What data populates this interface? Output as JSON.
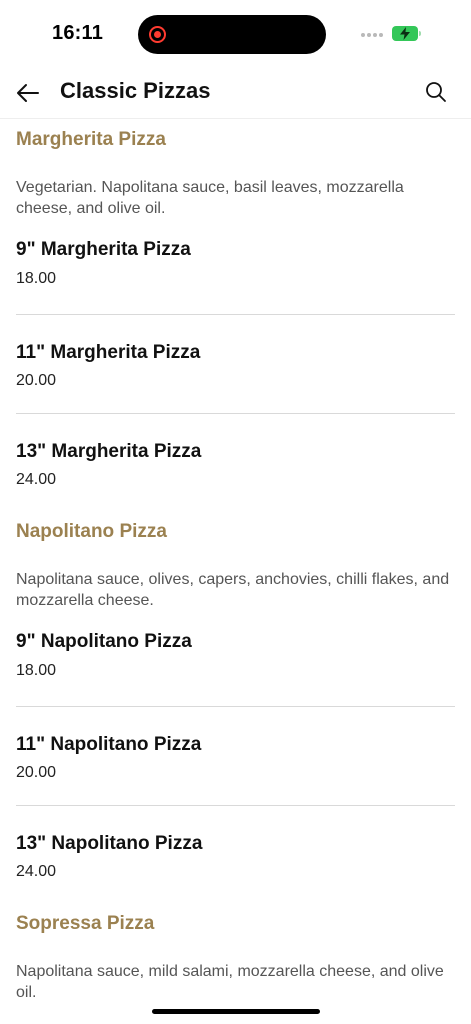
{
  "status_bar": {
    "time": "16:11"
  },
  "nav": {
    "title": "Classic Pizzas",
    "back_icon": "arrow-left-icon",
    "search_icon": "search-icon"
  },
  "colors": {
    "section_title": "#9b8150",
    "description": "#555555",
    "divider": "#d9d9d9",
    "battery": "#34c759",
    "recording": "#ff3b30"
  },
  "sections": [
    {
      "title": "Margherita Pizza",
      "description": "Vegetarian. Napolitana sauce, basil leaves, mozzarella cheese, and olive oil.",
      "items": [
        {
          "name": "9\" Margherita Pizza",
          "price": "18.00"
        },
        {
          "name": "11\" Margherita Pizza",
          "price": "20.00"
        },
        {
          "name": "13\" Margherita Pizza",
          "price": "24.00"
        }
      ]
    },
    {
      "title": "Napolitano Pizza",
      "description": "Napolitana sauce, olives, capers, anchovies, chilli flakes, and mozzarella cheese.",
      "items": [
        {
          "name": "9\" Napolitano Pizza",
          "price": "18.00"
        },
        {
          "name": "11\" Napolitano Pizza",
          "price": "20.00"
        },
        {
          "name": "13\" Napolitano Pizza",
          "price": "24.00"
        }
      ]
    },
    {
      "title": "Sopressa Pizza",
      "description": "Napolitana sauce, mild salami, mozzarella cheese, and olive oil.",
      "items": []
    }
  ]
}
